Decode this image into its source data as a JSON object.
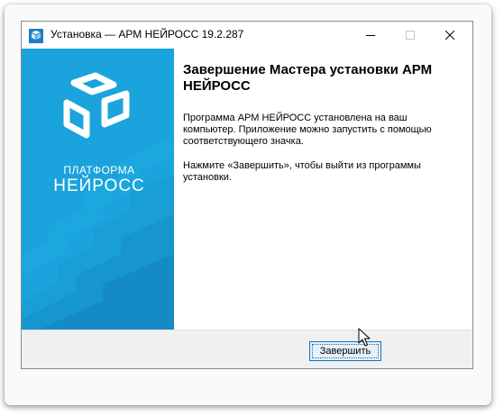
{
  "window": {
    "title": "Установка — АРМ НЕЙРОСС 19.2.287",
    "controls": {
      "minimize_icon": "minimize-icon",
      "maximize_icon": "maximize-icon",
      "close_icon": "close-icon"
    }
  },
  "sidebar": {
    "logo_line1": "ПЛАТФОРМА",
    "logo_line2": "НЕЙРОСС",
    "brand_color": "#1aa3dc"
  },
  "content": {
    "heading": "Завершение Мастера установки АРМ НЕЙРОСС",
    "paragraph1": "Программа АРМ НЕЙРОСС установлена на ваш компьютер. Приложение можно запустить с помощью соответствующего значка.",
    "paragraph2": "Нажмите «Завершить», чтобы выйти из программы установки."
  },
  "footer": {
    "finish_label": "Завершить"
  }
}
